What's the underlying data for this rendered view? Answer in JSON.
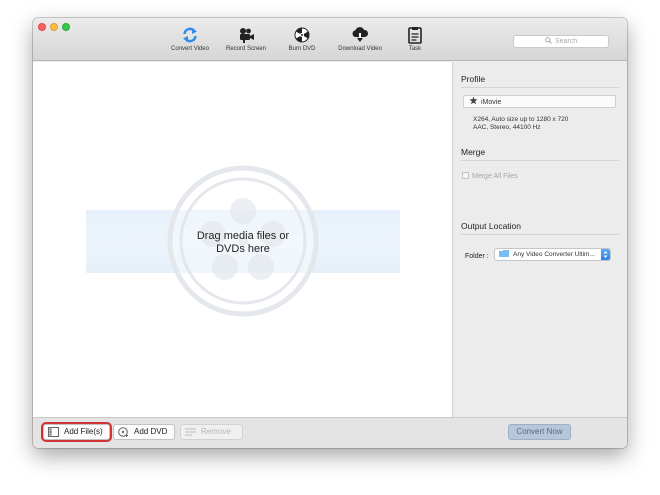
{
  "toolbar": {
    "items": [
      {
        "label": "Convert Video",
        "icon": "convert-video-icon"
      },
      {
        "label": "Record Screen",
        "icon": "record-screen-icon"
      },
      {
        "label": "Burn DVD",
        "icon": "burn-dvd-icon"
      },
      {
        "label": "Download Video",
        "icon": "download-video-icon"
      },
      {
        "label": "Task",
        "icon": "task-icon"
      }
    ],
    "search_placeholder": "Search"
  },
  "main": {
    "drop_text_line1": "Drag media files or",
    "drop_text_line2": "DVDs here"
  },
  "sidebar": {
    "profile_title": "Profile",
    "profile_name": "iMovie",
    "profile_desc_line1": "X264, Auto size up to 1280 x 720",
    "profile_desc_line2": "AAC, Stereo, 44100 Hz",
    "merge_title": "Merge",
    "merge_all_label": "Merge All Files",
    "output_title": "Output Location",
    "folder_label": "Folder :",
    "folder_value": "Any Video Converter Ultim..."
  },
  "bottombar": {
    "add_files_label": "Add File(s)",
    "add_dvd_label": "Add DVD",
    "remove_label": "Remove",
    "convert_label": "Convert Now"
  },
  "colors": {
    "accent_blue": "#2c7fe8",
    "highlight_red": "#d03434",
    "convert_button": "#b7c6d9"
  }
}
